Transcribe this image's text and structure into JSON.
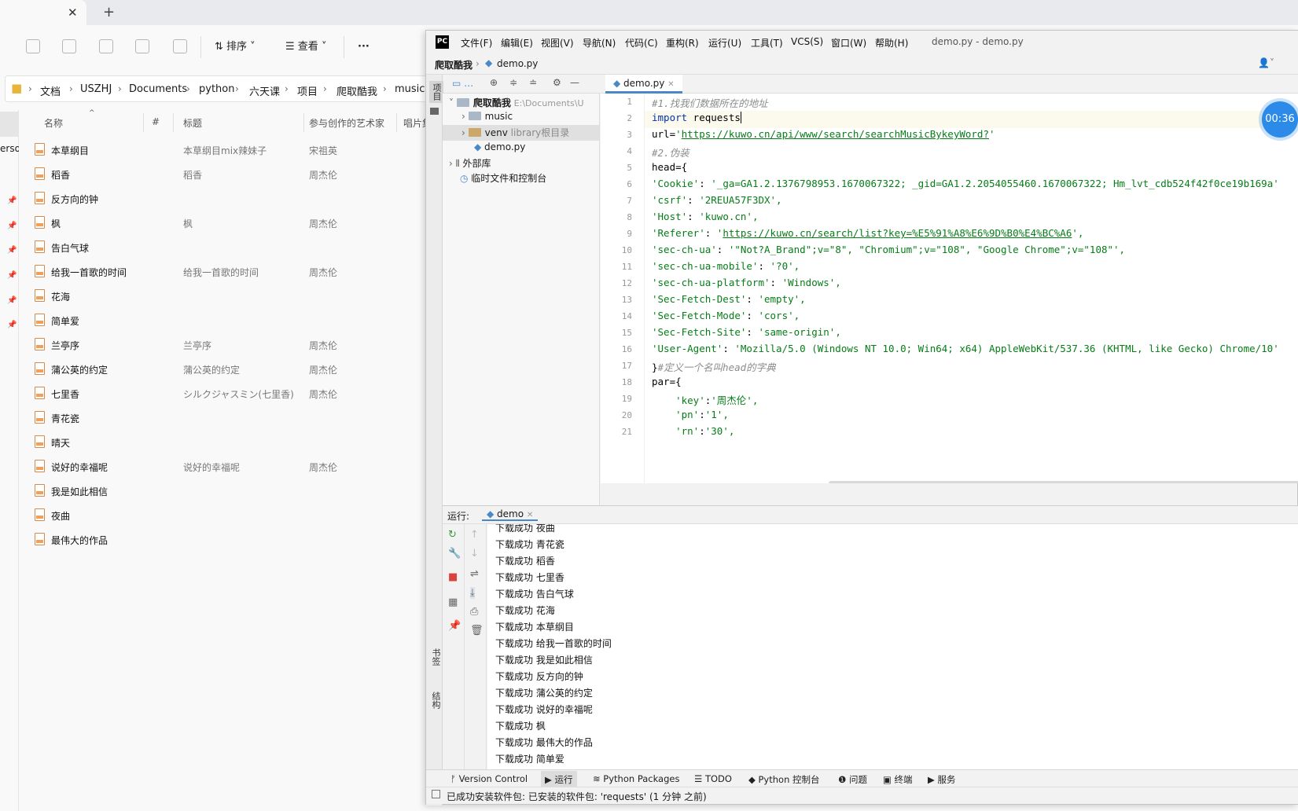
{
  "explorer": {
    "toolbar": {
      "sort": "排序",
      "view": "查看",
      "more": "···"
    },
    "breadcrumb": [
      "文档",
      "USZHJ",
      "Documents",
      "python",
      "六天课",
      "项目",
      "爬取酷我",
      "music"
    ],
    "columns": {
      "name": "名称",
      "num": "#",
      "title": "标题",
      "artist": "参与创作的艺术家",
      "album": "唱片集"
    },
    "left_partial": "erso",
    "files": [
      {
        "name": "本草纲目",
        "title": "本草纲目mix辣妹子",
        "artist": "宋祖英"
      },
      {
        "name": "稻香",
        "title": "稻香",
        "artist": "周杰伦"
      },
      {
        "name": "反方向的钟",
        "title": "",
        "artist": ""
      },
      {
        "name": "枫",
        "title": "枫",
        "artist": "周杰伦"
      },
      {
        "name": "告白气球",
        "title": "",
        "artist": ""
      },
      {
        "name": "给我一首歌的时间",
        "title": "给我一首歌的时间",
        "artist": "周杰伦"
      },
      {
        "name": "花海",
        "title": "",
        "artist": ""
      },
      {
        "name": "简单爱",
        "title": "",
        "artist": ""
      },
      {
        "name": "兰亭序",
        "title": "兰亭序",
        "artist": "周杰伦"
      },
      {
        "name": "蒲公英的约定",
        "title": "蒲公英的约定",
        "artist": "周杰伦"
      },
      {
        "name": "七里香",
        "title": "シルクジャスミン(七里香)",
        "artist": "周杰伦"
      },
      {
        "name": "青花瓷",
        "title": "",
        "artist": ""
      },
      {
        "name": "晴天",
        "title": "",
        "artist": ""
      },
      {
        "name": "说好的幸福呢",
        "title": "说好的幸福呢",
        "artist": "周杰伦"
      },
      {
        "name": "我是如此相信",
        "title": "",
        "artist": ""
      },
      {
        "name": "夜曲",
        "title": "",
        "artist": ""
      },
      {
        "name": "最伟大的作品",
        "title": "",
        "artist": ""
      }
    ]
  },
  "pycharm": {
    "logo": "PC",
    "menu": [
      "文件(F)",
      "编辑(E)",
      "视图(V)",
      "导航(N)",
      "代码(C)",
      "重构(R)",
      "运行(U)",
      "工具(T)",
      "VCS(S)",
      "窗口(W)",
      "帮助(H)"
    ],
    "window_title": "demo.py - demo.py",
    "nav": {
      "project": "爬取酷我",
      "file": "demo.py"
    },
    "side": {
      "project": "项目",
      "bookmarks": "书签",
      "structure": "结构"
    },
    "project_tree": {
      "root": "爬取酷我",
      "root_path": "E:\\Documents\\U",
      "music": "music",
      "venv": "venv",
      "venv_note": "library根目录",
      "demo": "demo.py",
      "external": "外部库",
      "scratch": "临时文件和控制台"
    },
    "editor_tab": "demo.py",
    "timer": "00:36",
    "run": {
      "label": "运行:",
      "config": "demo"
    },
    "console": [
      "下载成功 夜曲",
      "下载成功 青花瓷",
      "下载成功 稻香",
      "下载成功 七里香",
      "下载成功 告白气球",
      "下载成功 花海",
      "下载成功 本草纲目",
      "下载成功 给我一首歌的时间",
      "下载成功 我是如此相信",
      "下载成功 反方向的钟",
      "下载成功 蒲公英的约定",
      "下载成功 说好的幸福呢",
      "下载成功 枫",
      "下载成功 最伟大的作品",
      "下载成功 简单爱"
    ],
    "bottom_tabs": [
      "Version Control",
      "运行",
      "Python Packages",
      "TODO",
      "Python 控制台",
      "问题",
      "终端",
      "服务"
    ],
    "status": "已成功安装软件包: 已安装的软件包: 'requests' (1 分钟 之前)"
  }
}
